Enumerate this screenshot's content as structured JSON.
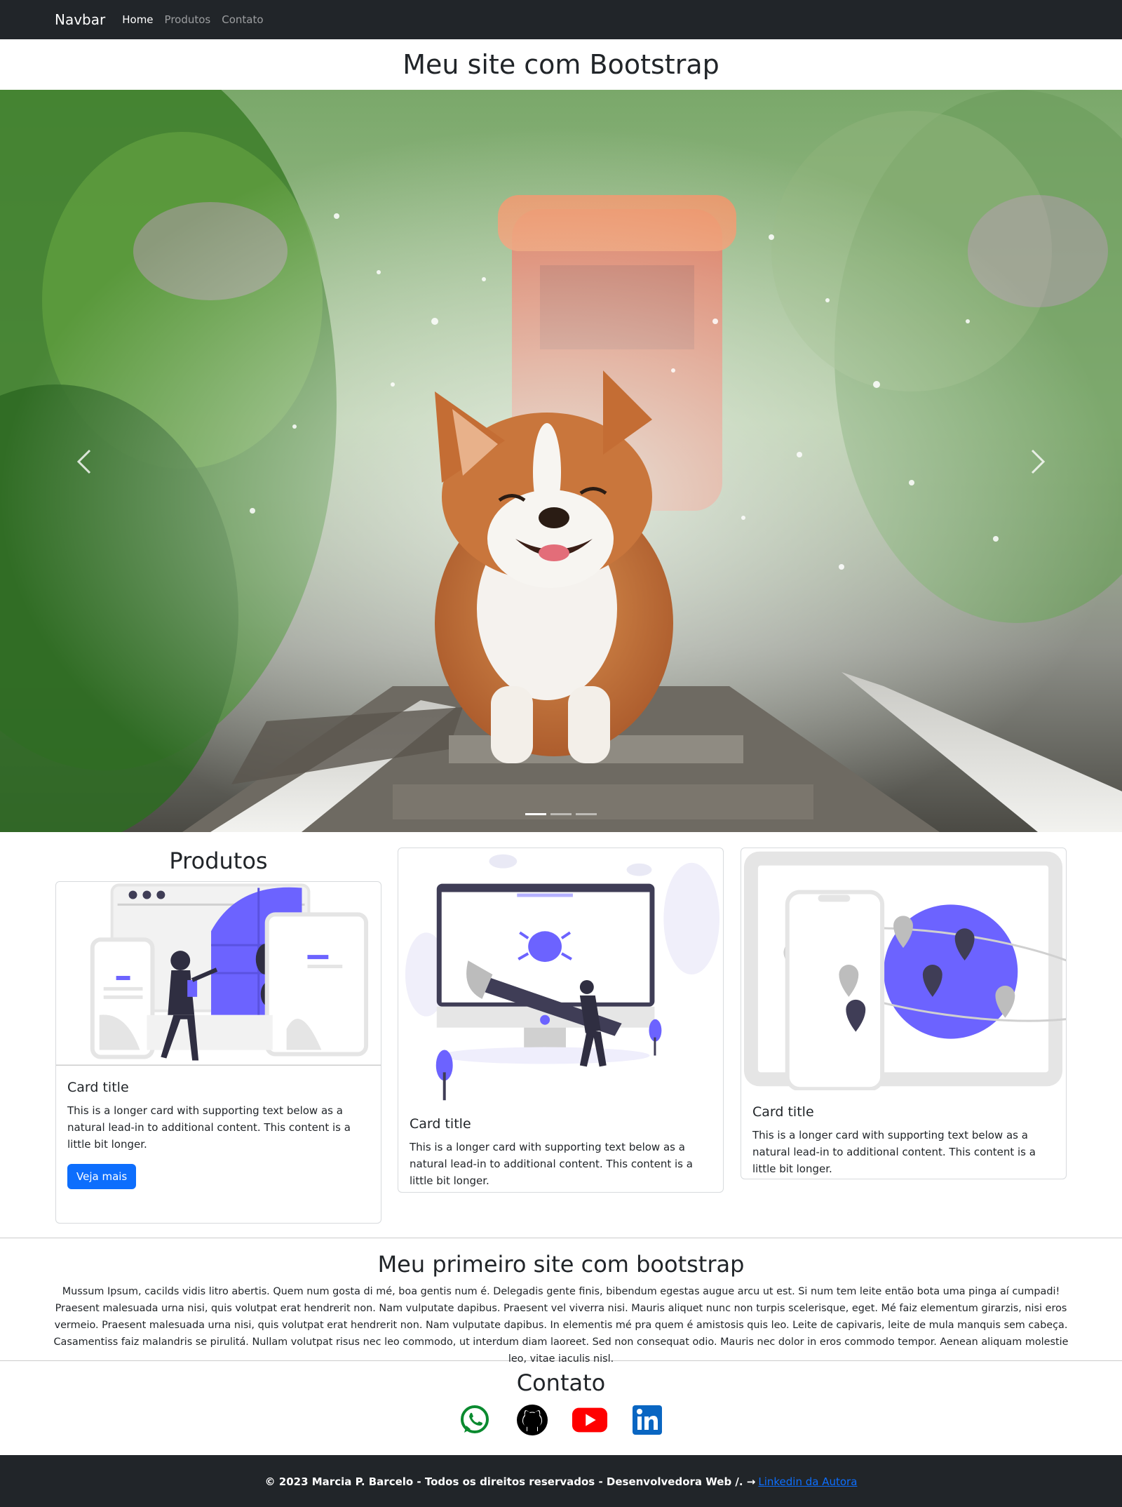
{
  "navbar": {
    "brand": "Navbar",
    "links": [
      "Home",
      "Produtos",
      "Contato"
    ]
  },
  "page_title": "Meu site com Bootstrap",
  "carousel": {
    "image": "corgi-on-railway-track",
    "slides": 3,
    "active_slide": 1
  },
  "produtos": {
    "title": "Produtos",
    "cards": [
      {
        "image": "web-design-illustration",
        "title": "Card title",
        "text": "This is a longer card with supporting text below as a natural lead-in to additional content. This content is a little bit longer.",
        "button": "Veja mais"
      },
      {
        "image": "bug-fixing-illustration",
        "title": "Card title",
        "text": "This is a longer card with supporting text below as a natural lead-in to additional content. This content is a little bit longer."
      },
      {
        "image": "map-locations-illustration",
        "title": "Card title",
        "text": "This is a longer card with supporting text below as a natural lead-in to additional content. This content is a little bit longer."
      }
    ]
  },
  "about": {
    "title": "Meu primeiro site com bootstrap",
    "text": "Mussum Ipsum, cacilds vidis litro abertis. Quem num gosta di mé, boa gentis num é. Delegadis gente finis, bibendum egestas augue arcu ut est. Si num tem leite então bota uma pinga aí cumpadi! Praesent malesuada urna nisi, quis volutpat erat hendrerit non. Nam vulputate dapibus. Praesent vel viverra nisi. Mauris aliquet nunc non turpis scelerisque, eget. Mé faiz elementum girarzis, nisi eros vermeio. Praesent malesuada urna nisi, quis volutpat erat hendrerit non. Nam vulputate dapibus. In elementis mé pra quem é amistosis quis leo. Leite de capivaris, leite de mula manquis sem cabeça. Casamentiss faiz malandris se pirulitá. Nullam volutpat risus nec leo commodo, ut interdum diam laoreet. Sed non consequat odio. Mauris nec dolor in eros commodo tempor. Aenean aliquam molestie leo, vitae iaculis nisl."
  },
  "contato": {
    "title": "Contato",
    "icons": [
      "whatsapp-icon",
      "github-icon",
      "youtube-icon",
      "linkedin-icon"
    ],
    "colors": {
      "whatsapp": "#0a8a2f",
      "github": "#000000",
      "youtube": "#ff0000",
      "linkedin": "#0a66c2"
    }
  },
  "footer": {
    "text": "© 2023 Marcia P. Barcelo - Todos os direitos reservados - Desenvolvedora Web /. →",
    "link": "Linkedin da Autora"
  },
  "colors": {
    "navbar_bg": "#212529",
    "primary": "#0d6efd",
    "accent_purple": "#6c63ff"
  }
}
